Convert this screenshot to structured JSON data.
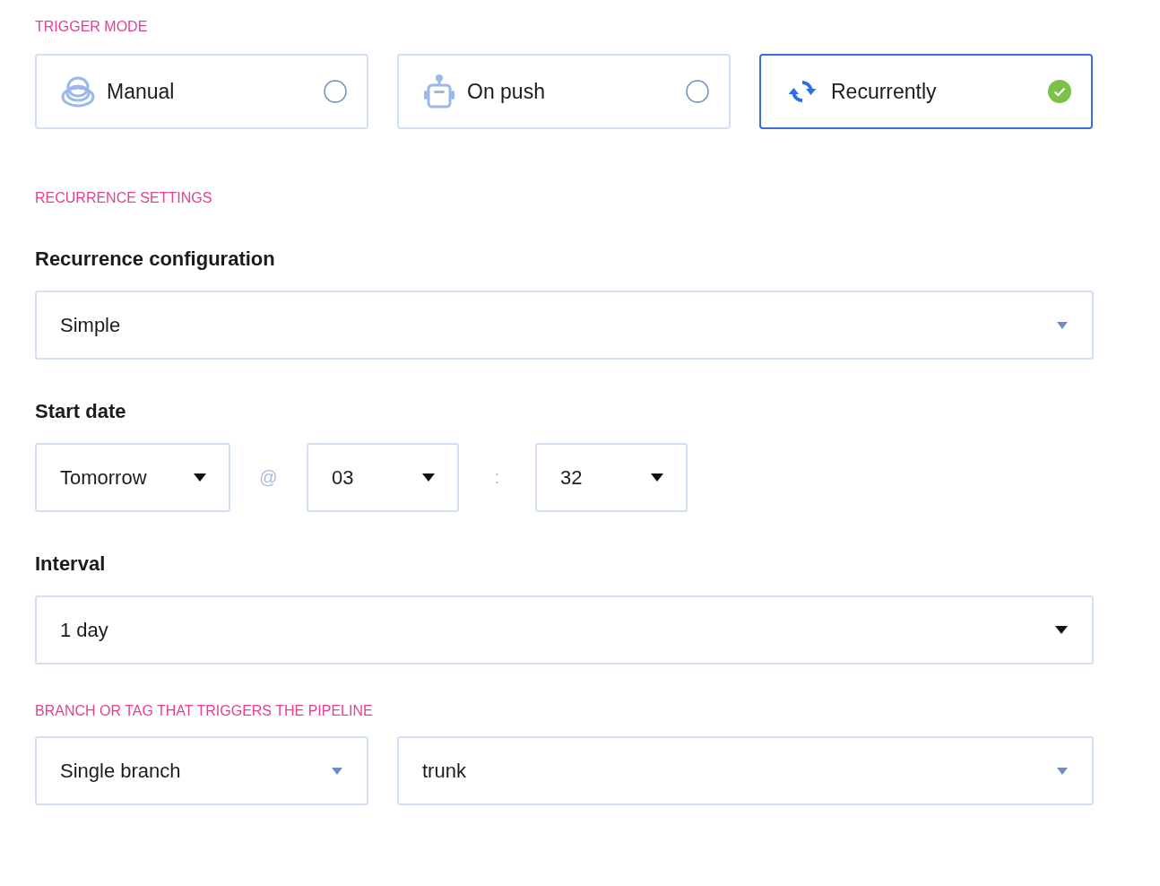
{
  "trigger_mode": {
    "heading": "TRIGGER MODE",
    "options": [
      {
        "label": "Manual",
        "kind": "manual",
        "selected": false
      },
      {
        "label": "On push",
        "kind": "push",
        "selected": false
      },
      {
        "label": "Recurrently",
        "kind": "recurrent",
        "selected": true
      }
    ]
  },
  "recurrence_settings": {
    "heading": "RECURRENCE SETTINGS",
    "configuration": {
      "label": "Recurrence configuration",
      "value": "Simple",
      "kind": "light"
    },
    "start_date": {
      "label": "Start date",
      "day": {
        "value": "Tomorrow",
        "kind": "dark"
      },
      "at": "@",
      "hour": {
        "value": "03",
        "kind": "dark"
      },
      "colon": ":",
      "minute": {
        "value": "32",
        "kind": "dark"
      }
    },
    "interval": {
      "label": "Interval",
      "value": "1 day",
      "kind": "dark"
    }
  },
  "branch": {
    "heading": "BRANCH OR TAG THAT TRIGGERS THE PIPELINE",
    "type": {
      "value": "Single branch",
      "kind": "light"
    },
    "name": {
      "value": "trunk",
      "kind": "light"
    }
  }
}
